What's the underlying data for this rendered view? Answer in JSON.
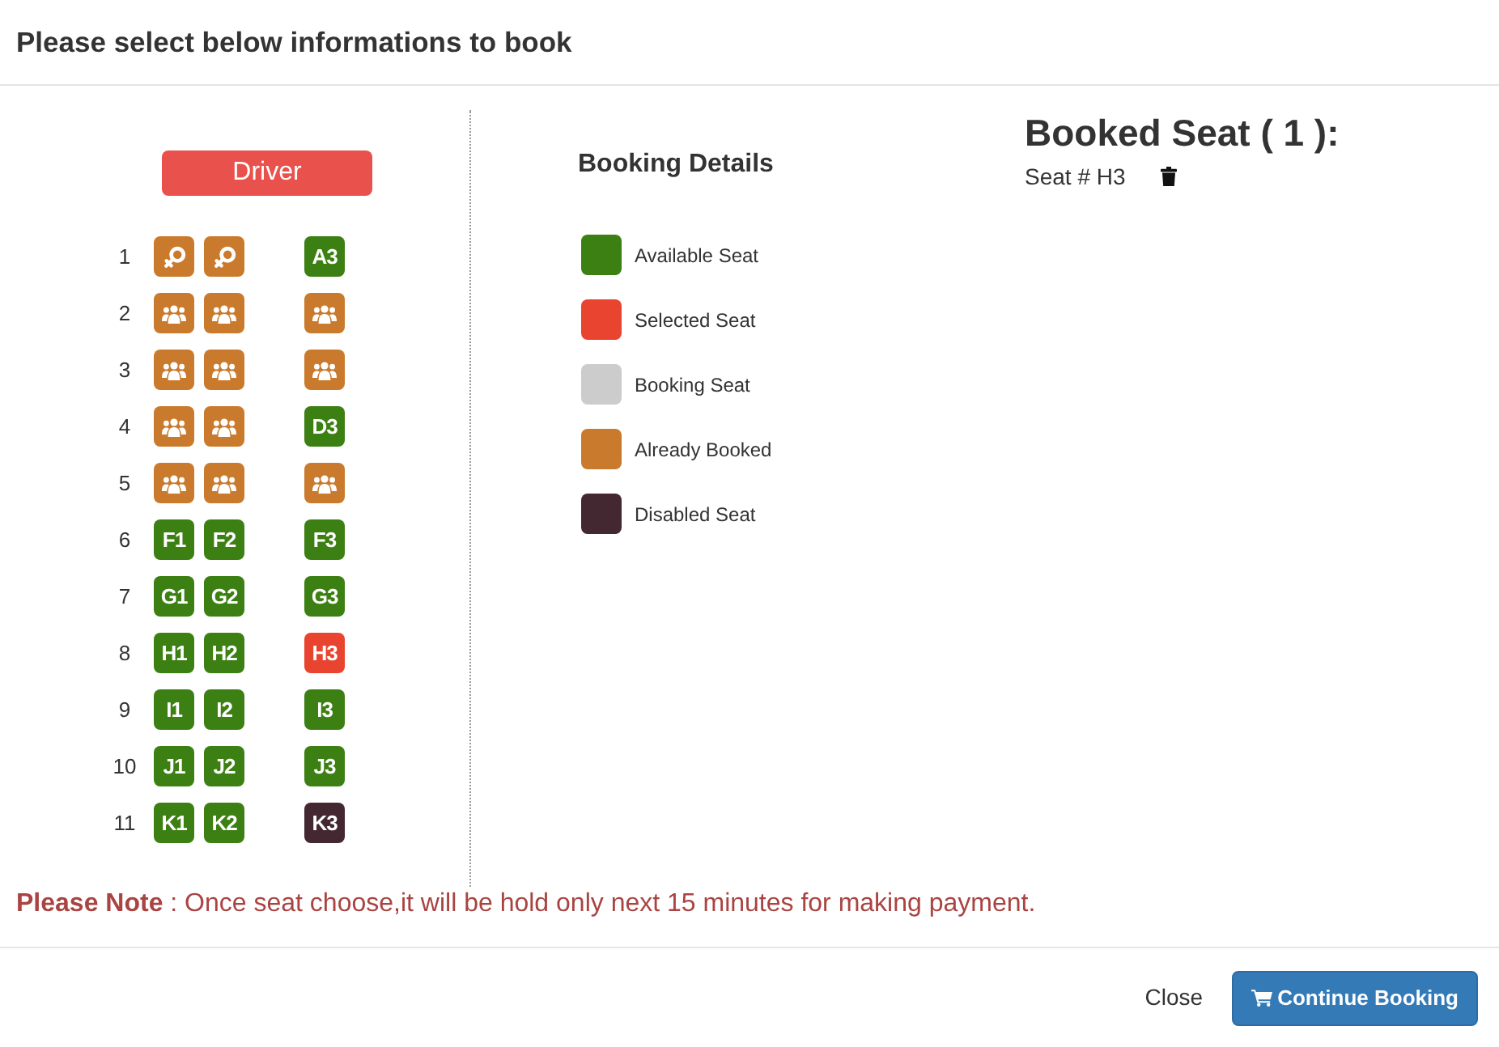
{
  "dialog": {
    "title": "Please select below informations to book"
  },
  "seat_map": {
    "driver_label": "Driver",
    "rows": [
      {
        "number": "1",
        "seats": [
          {
            "kind": "female",
            "booked": true,
            "selected": false,
            "disabled": false
          },
          {
            "kind": "female",
            "booked": true,
            "selected": false,
            "disabled": false
          },
          {
            "kind": "label",
            "label": "A3",
            "booked": false,
            "selected": false,
            "disabled": false
          }
        ]
      },
      {
        "number": "2",
        "seats": [
          {
            "kind": "group",
            "booked": true,
            "selected": false,
            "disabled": false
          },
          {
            "kind": "group",
            "booked": true,
            "selected": false,
            "disabled": false
          },
          {
            "kind": "group",
            "booked": true,
            "selected": false,
            "disabled": false
          }
        ]
      },
      {
        "number": "3",
        "seats": [
          {
            "kind": "group",
            "booked": true,
            "selected": false,
            "disabled": false
          },
          {
            "kind": "group",
            "booked": true,
            "selected": false,
            "disabled": false
          },
          {
            "kind": "group",
            "booked": true,
            "selected": false,
            "disabled": false
          }
        ]
      },
      {
        "number": "4",
        "seats": [
          {
            "kind": "group",
            "booked": true,
            "selected": false,
            "disabled": false
          },
          {
            "kind": "group",
            "booked": true,
            "selected": false,
            "disabled": false
          },
          {
            "kind": "label",
            "label": "D3",
            "booked": false,
            "selected": false,
            "disabled": false
          }
        ]
      },
      {
        "number": "5",
        "seats": [
          {
            "kind": "group",
            "booked": true,
            "selected": false,
            "disabled": false
          },
          {
            "kind": "group",
            "booked": true,
            "selected": false,
            "disabled": false
          },
          {
            "kind": "group",
            "booked": true,
            "selected": false,
            "disabled": false
          }
        ]
      },
      {
        "number": "6",
        "seats": [
          {
            "kind": "label",
            "label": "F1",
            "booked": false,
            "selected": false,
            "disabled": false
          },
          {
            "kind": "label",
            "label": "F2",
            "booked": false,
            "selected": false,
            "disabled": false
          },
          {
            "kind": "label",
            "label": "F3",
            "booked": false,
            "selected": false,
            "disabled": false
          }
        ]
      },
      {
        "number": "7",
        "seats": [
          {
            "kind": "label",
            "label": "G1",
            "booked": false,
            "selected": false,
            "disabled": false
          },
          {
            "kind": "label",
            "label": "G2",
            "booked": false,
            "selected": false,
            "disabled": false
          },
          {
            "kind": "label",
            "label": "G3",
            "booked": false,
            "selected": false,
            "disabled": false
          }
        ]
      },
      {
        "number": "8",
        "seats": [
          {
            "kind": "label",
            "label": "H1",
            "booked": false,
            "selected": false,
            "disabled": false
          },
          {
            "kind": "label",
            "label": "H2",
            "booked": false,
            "selected": false,
            "disabled": false
          },
          {
            "kind": "label",
            "label": "H3",
            "booked": false,
            "selected": true,
            "disabled": false
          }
        ]
      },
      {
        "number": "9",
        "seats": [
          {
            "kind": "label",
            "label": "I1",
            "booked": false,
            "selected": false,
            "disabled": false
          },
          {
            "kind": "label",
            "label": "I2",
            "booked": false,
            "selected": false,
            "disabled": false
          },
          {
            "kind": "label",
            "label": "I3",
            "booked": false,
            "selected": false,
            "disabled": false
          }
        ]
      },
      {
        "number": "10",
        "seats": [
          {
            "kind": "label",
            "label": "J1",
            "booked": false,
            "selected": false,
            "disabled": false
          },
          {
            "kind": "label",
            "label": "J2",
            "booked": false,
            "selected": false,
            "disabled": false
          },
          {
            "kind": "label",
            "label": "J3",
            "booked": false,
            "selected": false,
            "disabled": false
          }
        ]
      },
      {
        "number": "11",
        "seats": [
          {
            "kind": "label",
            "label": "K1",
            "booked": false,
            "selected": false,
            "disabled": false
          },
          {
            "kind": "label",
            "label": "K2",
            "booked": false,
            "selected": false,
            "disabled": false
          },
          {
            "kind": "label",
            "label": "K3",
            "booked": false,
            "selected": false,
            "disabled": true
          }
        ]
      }
    ]
  },
  "legend": {
    "title": "Booking Details",
    "items": [
      {
        "label": "Available Seat",
        "color": "#3c7f12"
      },
      {
        "label": "Selected Seat",
        "color": "#e8442f"
      },
      {
        "label": "Booking Seat",
        "color": "#cccccc"
      },
      {
        "label": "Already Booked",
        "color": "#c97a2c"
      },
      {
        "label": "Disabled Seat",
        "color": "#432731"
      }
    ]
  },
  "booked_seats": {
    "heading": "Booked Seat ( 1 ):",
    "items": [
      {
        "label": "Seat # H3"
      }
    ]
  },
  "note": "**Please Note** : Once seat choose,it will be hold only next 15 minutes for making payment.",
  "buttons": [
    {
      "kind": "plain",
      "label": "Close"
    },
    {
      "kind": "primary",
      "label": "Continue Booking"
    }
  ]
}
